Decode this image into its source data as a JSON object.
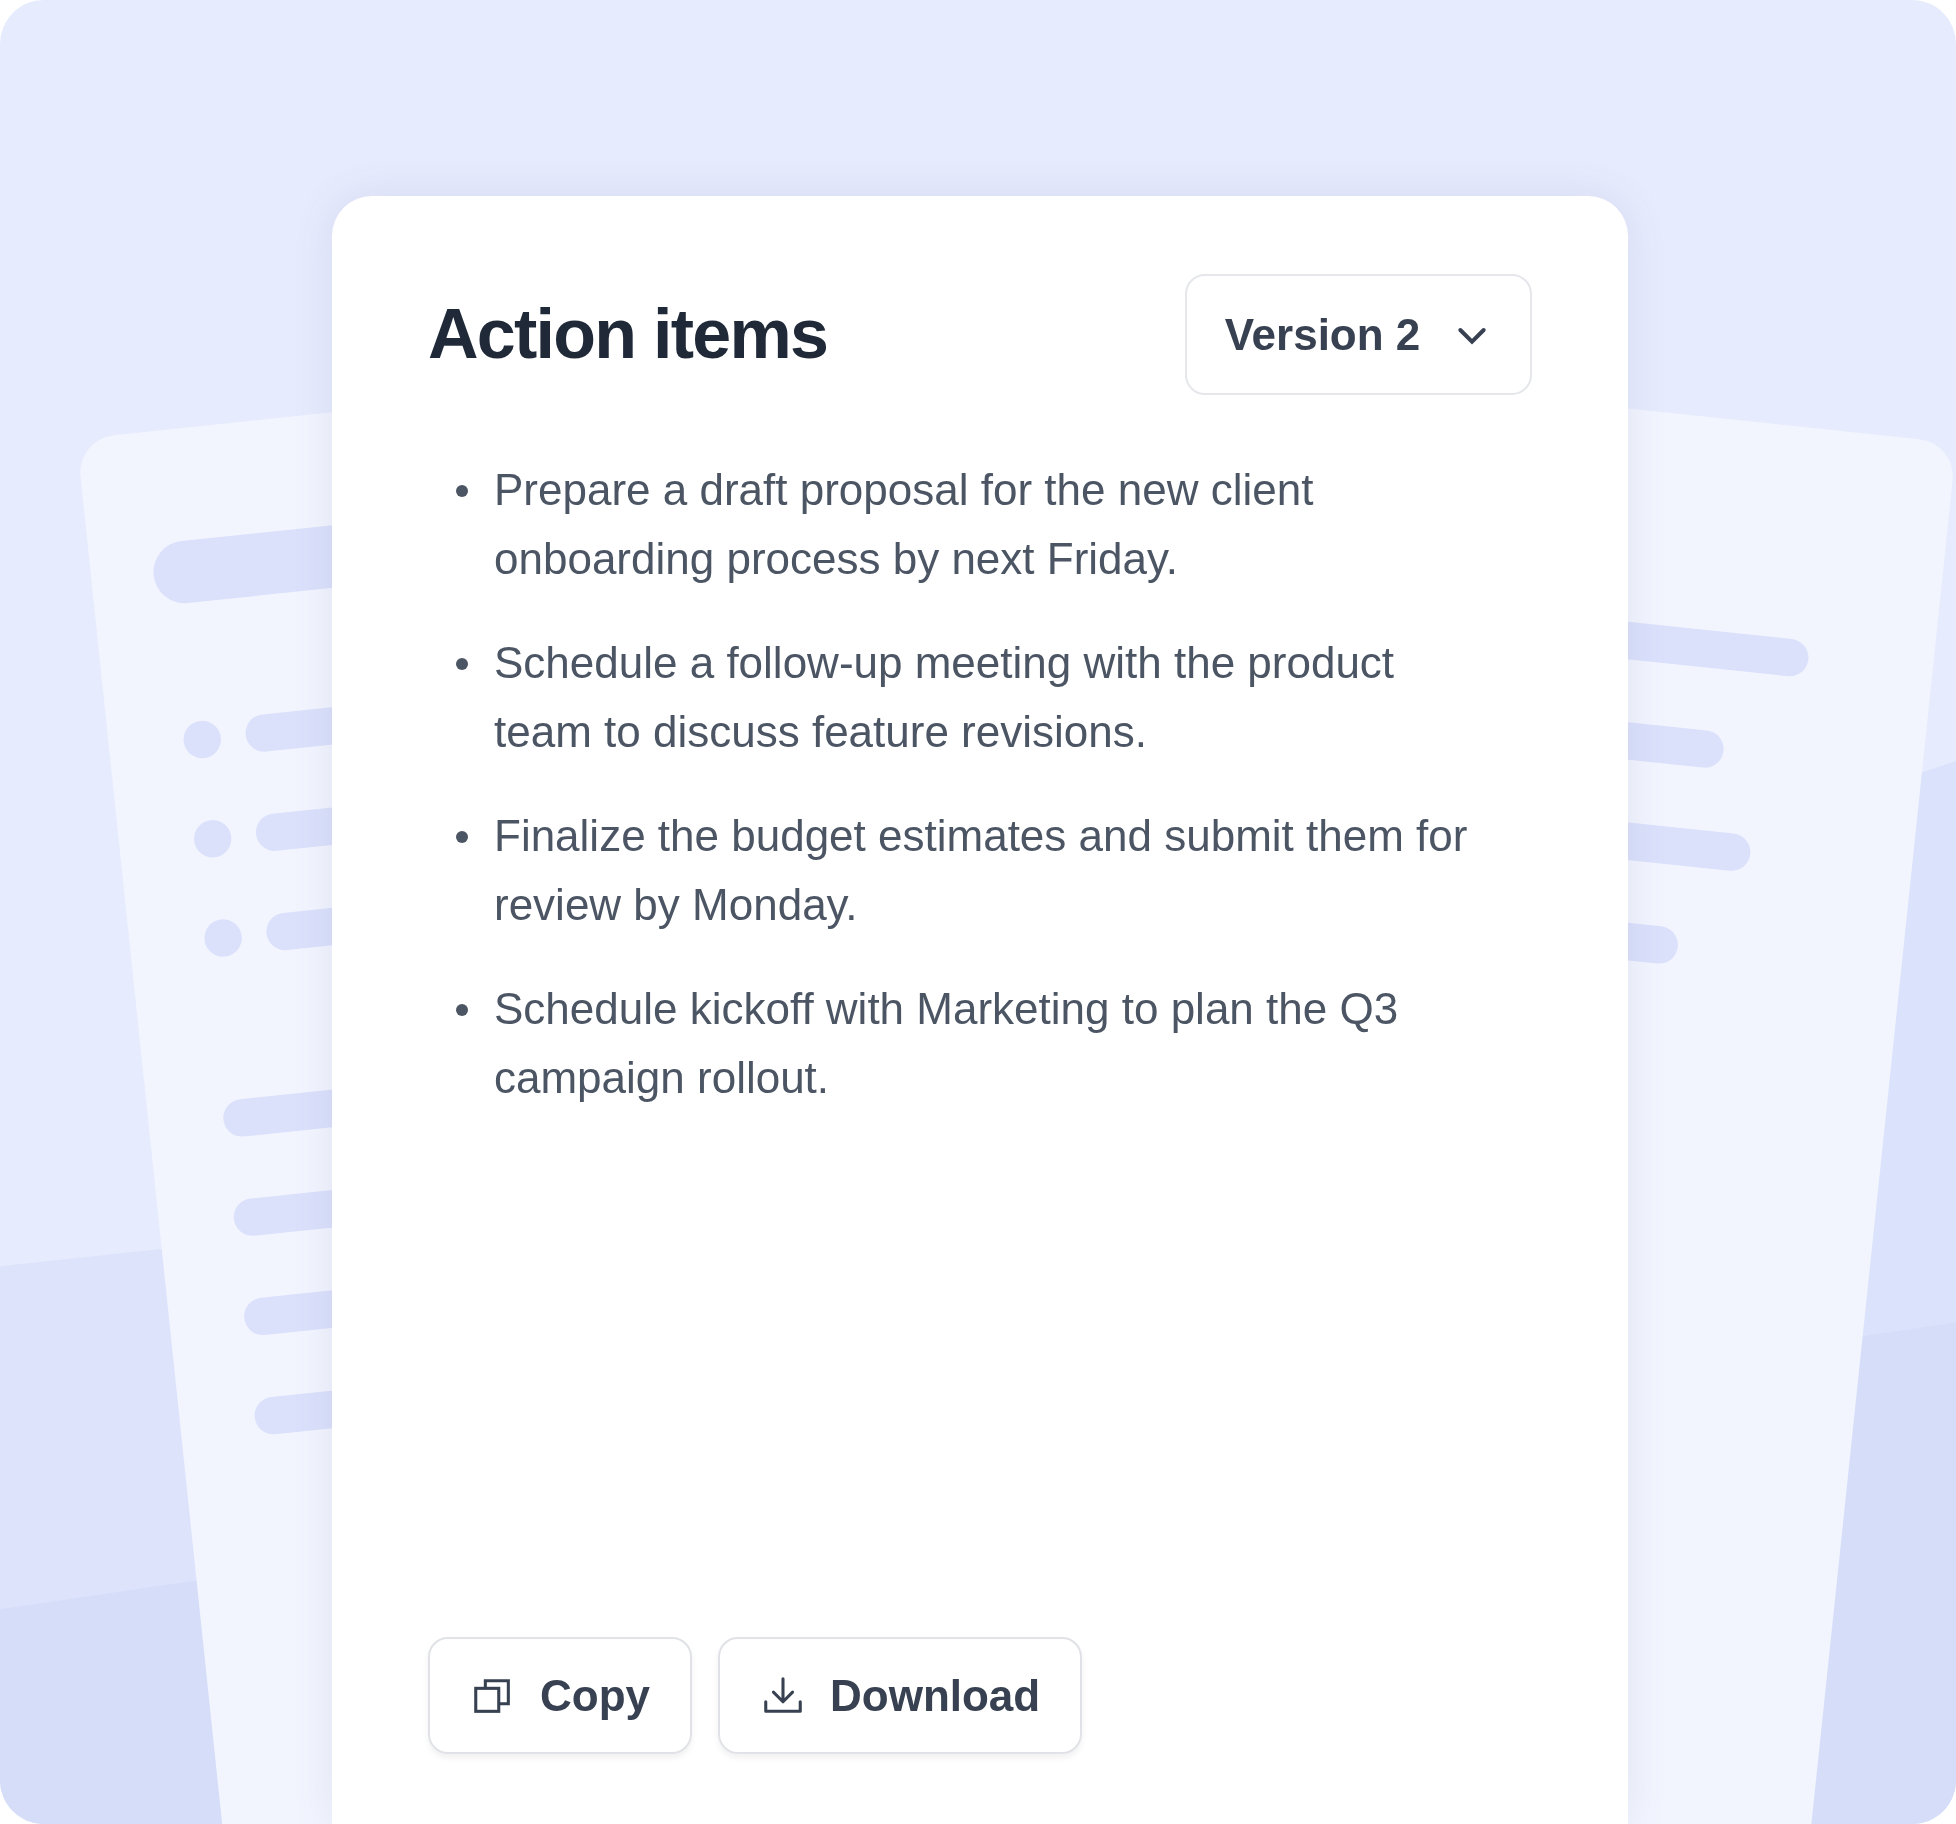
{
  "card": {
    "title": "Action items",
    "version_select": {
      "value": "Version 2"
    }
  },
  "action_items": [
    "Prepare a draft proposal for the new client onboarding process by next Friday.",
    "Schedule a follow-up meeting with the product team to discuss feature revisions.",
    "Finalize the budget estimates and submit them for review by Monday.",
    "Schedule kickoff with Marketing to plan the Q3 campaign rollout."
  ],
  "buttons": [
    {
      "kind": "copy",
      "label": "Copy"
    },
    {
      "kind": "download",
      "label": "Download"
    }
  ]
}
